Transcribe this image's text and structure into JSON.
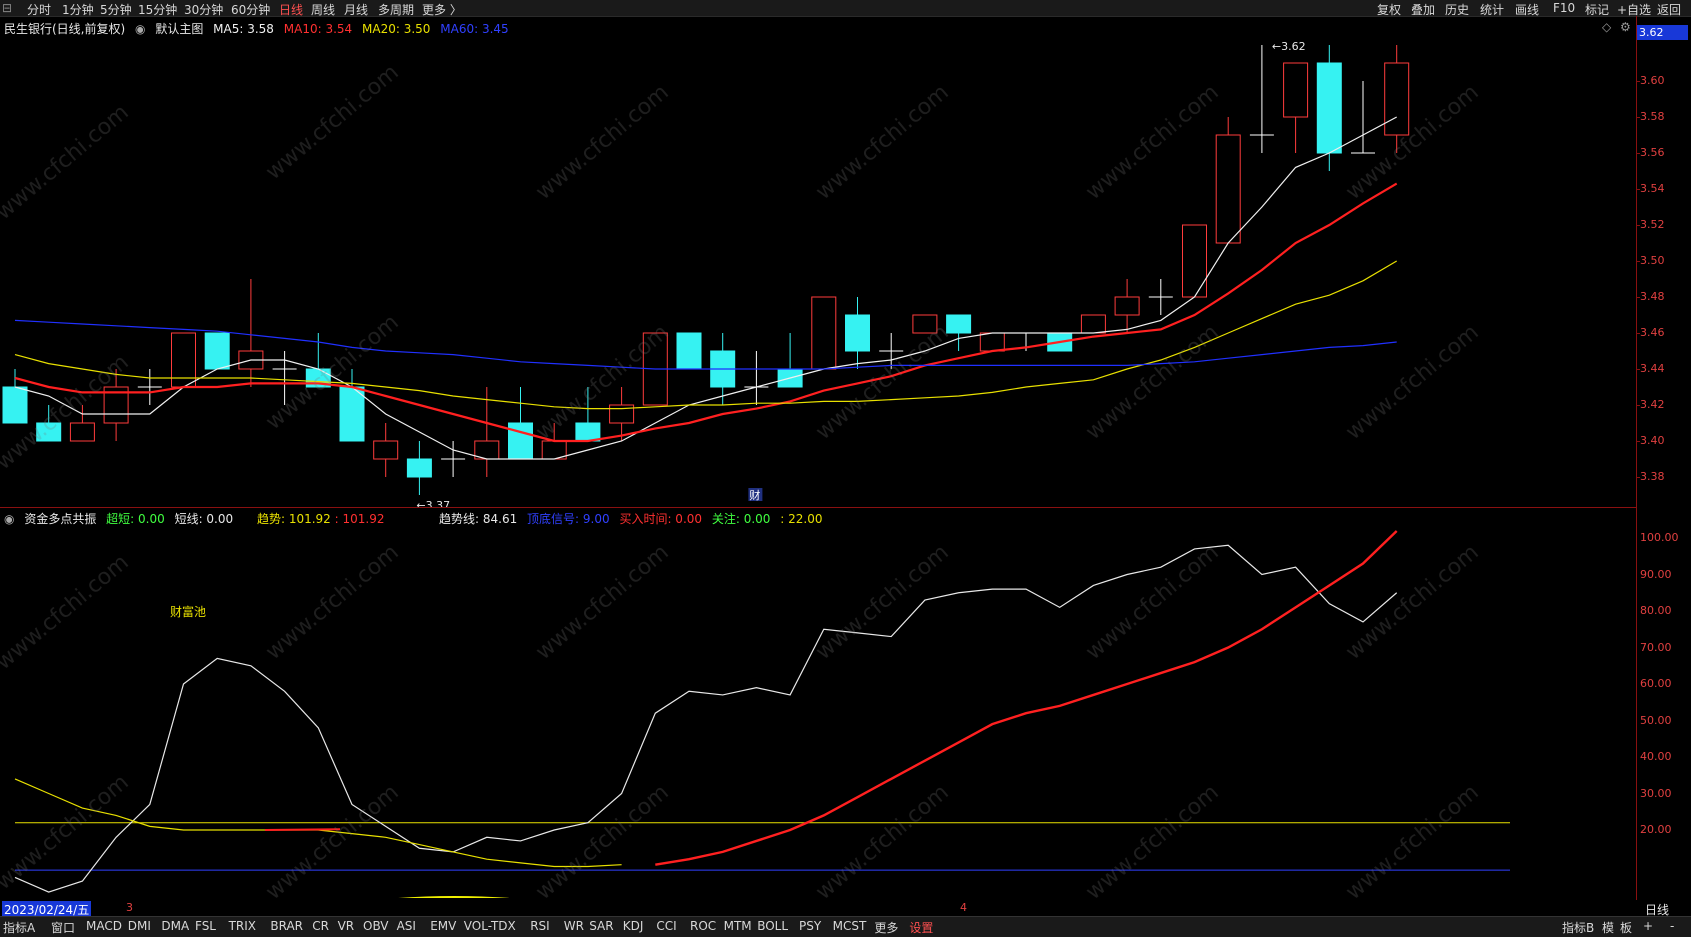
{
  "top_menu": {
    "periods": [
      "分时",
      "1分钟",
      "5分钟",
      "15分钟",
      "30分钟",
      "60分钟",
      "日线",
      "周线",
      "月线",
      "多周期",
      "更多 〉"
    ],
    "active_period": "日线",
    "right_items": [
      "复权",
      "叠加",
      "历史",
      "统计",
      "画线",
      "F10",
      "标记",
      "+自选",
      "返回"
    ]
  },
  "main_legend": {
    "stock": "民生银行(日线,前复权)",
    "template": "默认主图",
    "ma5": "MA5: 3.58",
    "ma10": "MA10: 3.54",
    "ma20": "MA20: 3.50",
    "ma60": "MA60: 3.45"
  },
  "price_axis": {
    "current_price": "3.62",
    "labels": [
      "3.60",
      "3.58",
      "3.56",
      "3.54",
      "3.52",
      "3.50",
      "3.48",
      "3.46",
      "3.44",
      "3.42",
      "3.40",
      "3.38"
    ]
  },
  "annotations": {
    "high_label": "3.62",
    "low_label": "3.37",
    "cai_marker": "财"
  },
  "indicator_legend": {
    "name": "资金多点共振",
    "chaodi": "超短: 0.00",
    "duanxian": "短线: 0.00",
    "qushi": "趋势: 101.92",
    "qushi2": ": 101.92",
    "qushixian": "趋势线: 84.61",
    "dingdi": "顶底信号: 9.00",
    "mairu": "买入时间: 0.00",
    "guanzhu": "关注: 0.00",
    "extra": ": 22.00"
  },
  "indicator_axis": {
    "labels": [
      "100.00",
      "90.00",
      "80.00",
      "70.00",
      "60.00",
      "50.00",
      "40.00",
      "30.00",
      "20.00"
    ]
  },
  "indicator_text": {
    "wealth_pool": "财富池"
  },
  "date_bar": {
    "current_date": "2023/02/24/五",
    "month_mark_1": "3",
    "month_mark_2": "4",
    "right_label": "日线"
  },
  "bottom_tabs": {
    "left": [
      "指标A",
      "窗口",
      "MACD",
      "DMI",
      "DMA",
      "FSL",
      "TRIX",
      "BRAR",
      "CR",
      "VR",
      "OBV",
      "ASI",
      "EMV",
      "VOL-TDX",
      "RSI",
      "WR",
      "SAR",
      "KDJ",
      "CCI",
      "ROC",
      "MTM",
      "BOLL",
      "PSY",
      "MCST",
      "更多",
      "设置"
    ],
    "right": [
      "指标B",
      "模",
      "板",
      "+",
      "-"
    ]
  },
  "watermark_text": "www.cfchi.com",
  "colors": {
    "up": "#ff3c3c",
    "down": "#36f2f2",
    "ma5": "#f0f0f0",
    "ma10": "#ff2020",
    "ma20": "#e8e000",
    "ma60": "#2030ff"
  },
  "chart_data": [
    {
      "type": "candlestick",
      "title": "民生银行(日线,前复权)",
      "ylim": [
        3.365,
        3.625
      ],
      "candles": [
        {
          "o": 3.43,
          "h": 3.44,
          "l": 3.41,
          "c": 3.41
        },
        {
          "o": 3.41,
          "h": 3.42,
          "l": 3.4,
          "c": 3.4
        },
        {
          "o": 3.4,
          "h": 3.42,
          "l": 3.4,
          "c": 3.41
        },
        {
          "o": 3.41,
          "h": 3.44,
          "l": 3.4,
          "c": 3.43
        },
        {
          "o": 3.43,
          "h": 3.44,
          "l": 3.42,
          "c": 3.43
        },
        {
          "o": 3.43,
          "h": 3.46,
          "l": 3.43,
          "c": 3.46
        },
        {
          "o": 3.46,
          "h": 3.46,
          "l": 3.44,
          "c": 3.44
        },
        {
          "o": 3.44,
          "h": 3.49,
          "l": 3.43,
          "c": 3.45
        },
        {
          "o": 3.44,
          "h": 3.45,
          "l": 3.42,
          "c": 3.44
        },
        {
          "o": 3.44,
          "h": 3.46,
          "l": 3.43,
          "c": 3.43
        },
        {
          "o": 3.43,
          "h": 3.44,
          "l": 3.4,
          "c": 3.4
        },
        {
          "o": 3.39,
          "h": 3.41,
          "l": 3.38,
          "c": 3.4
        },
        {
          "o": 3.39,
          "h": 3.4,
          "l": 3.37,
          "c": 3.38
        },
        {
          "o": 3.39,
          "h": 3.4,
          "l": 3.38,
          "c": 3.39
        },
        {
          "o": 3.39,
          "h": 3.43,
          "l": 3.38,
          "c": 3.4
        },
        {
          "o": 3.41,
          "h": 3.43,
          "l": 3.39,
          "c": 3.39
        },
        {
          "o": 3.39,
          "h": 3.41,
          "l": 3.39,
          "c": 3.4
        },
        {
          "o": 3.41,
          "h": 3.43,
          "l": 3.4,
          "c": 3.4
        },
        {
          "o": 3.41,
          "h": 3.43,
          "l": 3.4,
          "c": 3.42
        },
        {
          "o": 3.42,
          "h": 3.46,
          "l": 3.42,
          "c": 3.46
        },
        {
          "o": 3.46,
          "h": 3.46,
          "l": 3.44,
          "c": 3.44
        },
        {
          "o": 3.45,
          "h": 3.46,
          "l": 3.42,
          "c": 3.43
        },
        {
          "o": 3.43,
          "h": 3.45,
          "l": 3.42,
          "c": 3.43
        },
        {
          "o": 3.44,
          "h": 3.46,
          "l": 3.43,
          "c": 3.43
        },
        {
          "o": 3.44,
          "h": 3.48,
          "l": 3.44,
          "c": 3.48
        },
        {
          "o": 3.47,
          "h": 3.48,
          "l": 3.44,
          "c": 3.45
        },
        {
          "o": 3.45,
          "h": 3.46,
          "l": 3.44,
          "c": 3.45
        },
        {
          "o": 3.46,
          "h": 3.47,
          "l": 3.46,
          "c": 3.47
        },
        {
          "o": 3.47,
          "h": 3.47,
          "l": 3.45,
          "c": 3.46
        },
        {
          "o": 3.45,
          "h": 3.46,
          "l": 3.45,
          "c": 3.46
        },
        {
          "o": 3.46,
          "h": 3.46,
          "l": 3.45,
          "c": 3.46
        },
        {
          "o": 3.46,
          "h": 3.46,
          "l": 3.45,
          "c": 3.45
        },
        {
          "o": 3.46,
          "h": 3.47,
          "l": 3.46,
          "c": 3.47
        },
        {
          "o": 3.47,
          "h": 3.49,
          "l": 3.46,
          "c": 3.48
        },
        {
          "o": 3.48,
          "h": 3.49,
          "l": 3.47,
          "c": 3.48
        },
        {
          "o": 3.48,
          "h": 3.52,
          "l": 3.48,
          "c": 3.52
        },
        {
          "o": 3.51,
          "h": 3.58,
          "l": 3.51,
          "c": 3.57
        },
        {
          "o": 3.57,
          "h": 3.62,
          "l": 3.56,
          "c": 3.57
        },
        {
          "o": 3.58,
          "h": 3.61,
          "l": 3.56,
          "c": 3.61
        },
        {
          "o": 3.61,
          "h": 3.62,
          "l": 3.55,
          "c": 3.56
        },
        {
          "o": 3.56,
          "h": 3.6,
          "l": 3.56,
          "c": 3.56
        },
        {
          "o": 3.57,
          "h": 3.62,
          "l": 3.56,
          "c": 3.61
        }
      ],
      "series": [
        {
          "name": "MA5",
          "values": [
            3.43,
            3.425,
            3.415,
            3.415,
            3.415,
            3.43,
            3.44,
            3.445,
            3.445,
            3.44,
            3.43,
            3.415,
            3.405,
            3.395,
            3.39,
            3.39,
            3.39,
            3.395,
            3.4,
            3.41,
            3.42,
            3.425,
            3.43,
            3.435,
            3.44,
            3.443,
            3.445,
            3.45,
            3.457,
            3.46,
            3.46,
            3.46,
            3.46,
            3.462,
            3.467,
            3.48,
            3.51,
            3.53,
            3.552,
            3.56,
            3.57,
            3.58
          ]
        },
        {
          "name": "MA10",
          "values": [
            3.435,
            3.43,
            3.427,
            3.427,
            3.427,
            3.43,
            3.43,
            3.432,
            3.432,
            3.432,
            3.43,
            3.425,
            3.42,
            3.415,
            3.41,
            3.405,
            3.4,
            3.4,
            3.403,
            3.407,
            3.41,
            3.415,
            3.418,
            3.422,
            3.428,
            3.432,
            3.436,
            3.442,
            3.446,
            3.45,
            3.452,
            3.455,
            3.458,
            3.46,
            3.462,
            3.47,
            3.482,
            3.495,
            3.51,
            3.52,
            3.532,
            3.543
          ]
        },
        {
          "name": "MA20",
          "values": [
            3.448,
            3.443,
            3.44,
            3.437,
            3.435,
            3.435,
            3.435,
            3.435,
            3.434,
            3.433,
            3.432,
            3.43,
            3.428,
            3.425,
            3.423,
            3.421,
            3.419,
            3.418,
            3.418,
            3.419,
            3.42,
            3.42,
            3.421,
            3.421,
            3.422,
            3.422,
            3.423,
            3.424,
            3.425,
            3.427,
            3.43,
            3.432,
            3.434,
            3.44,
            3.445,
            3.452,
            3.46,
            3.468,
            3.476,
            3.481,
            3.489,
            3.5
          ]
        },
        {
          "name": "MA60",
          "values": [
            3.467,
            3.466,
            3.465,
            3.464,
            3.463,
            3.462,
            3.461,
            3.459,
            3.457,
            3.455,
            3.452,
            3.45,
            3.449,
            3.448,
            3.446,
            3.444,
            3.443,
            3.442,
            3.441,
            3.44,
            3.44,
            3.44,
            3.44,
            3.44,
            3.44,
            3.441,
            3.442,
            3.442,
            3.442,
            3.442,
            3.442,
            3.442,
            3.442,
            3.442,
            3.443,
            3.444,
            3.446,
            3.448,
            3.45,
            3.452,
            3.453,
            3.455
          ]
        }
      ]
    },
    {
      "type": "line",
      "title": "资金多点共振",
      "ylim": [
        0,
        105
      ],
      "series": [
        {
          "name": "趋势线",
          "values": [
            7,
            3,
            6,
            18,
            27,
            60,
            67,
            65,
            58,
            48,
            27,
            21,
            15,
            14,
            18,
            17,
            20,
            22,
            30,
            52,
            58,
            57,
            59,
            57,
            75,
            74,
            73,
            83,
            85,
            86,
            86,
            81,
            87,
            90,
            92,
            97,
            98,
            90,
            92,
            82,
            77,
            85
          ]
        },
        {
          "name": "趋势",
          "values": [
            null,
            null,
            null,
            null,
            null,
            null,
            null,
            null,
            null,
            null,
            null,
            null,
            null,
            null,
            null,
            null,
            null,
            null,
            null,
            10.5,
            12,
            14,
            17,
            20,
            24,
            29,
            34,
            39,
            44,
            49,
            52,
            54,
            57,
            60,
            63,
            66,
            70,
            75,
            81,
            87,
            93,
            101.92
          ]
        },
        {
          "name": "黄线",
          "values": [
            34,
            30,
            26,
            24,
            21,
            20,
            20,
            20,
            20,
            20,
            19,
            18,
            16,
            14,
            12,
            11,
            10,
            10,
            10.5,
            null,
            null,
            null,
            null,
            null,
            null,
            null,
            null,
            null,
            null,
            null,
            null,
            null,
            null,
            null,
            null,
            null,
            null,
            null,
            null,
            null,
            null,
            null
          ]
        }
      ]
    }
  ]
}
